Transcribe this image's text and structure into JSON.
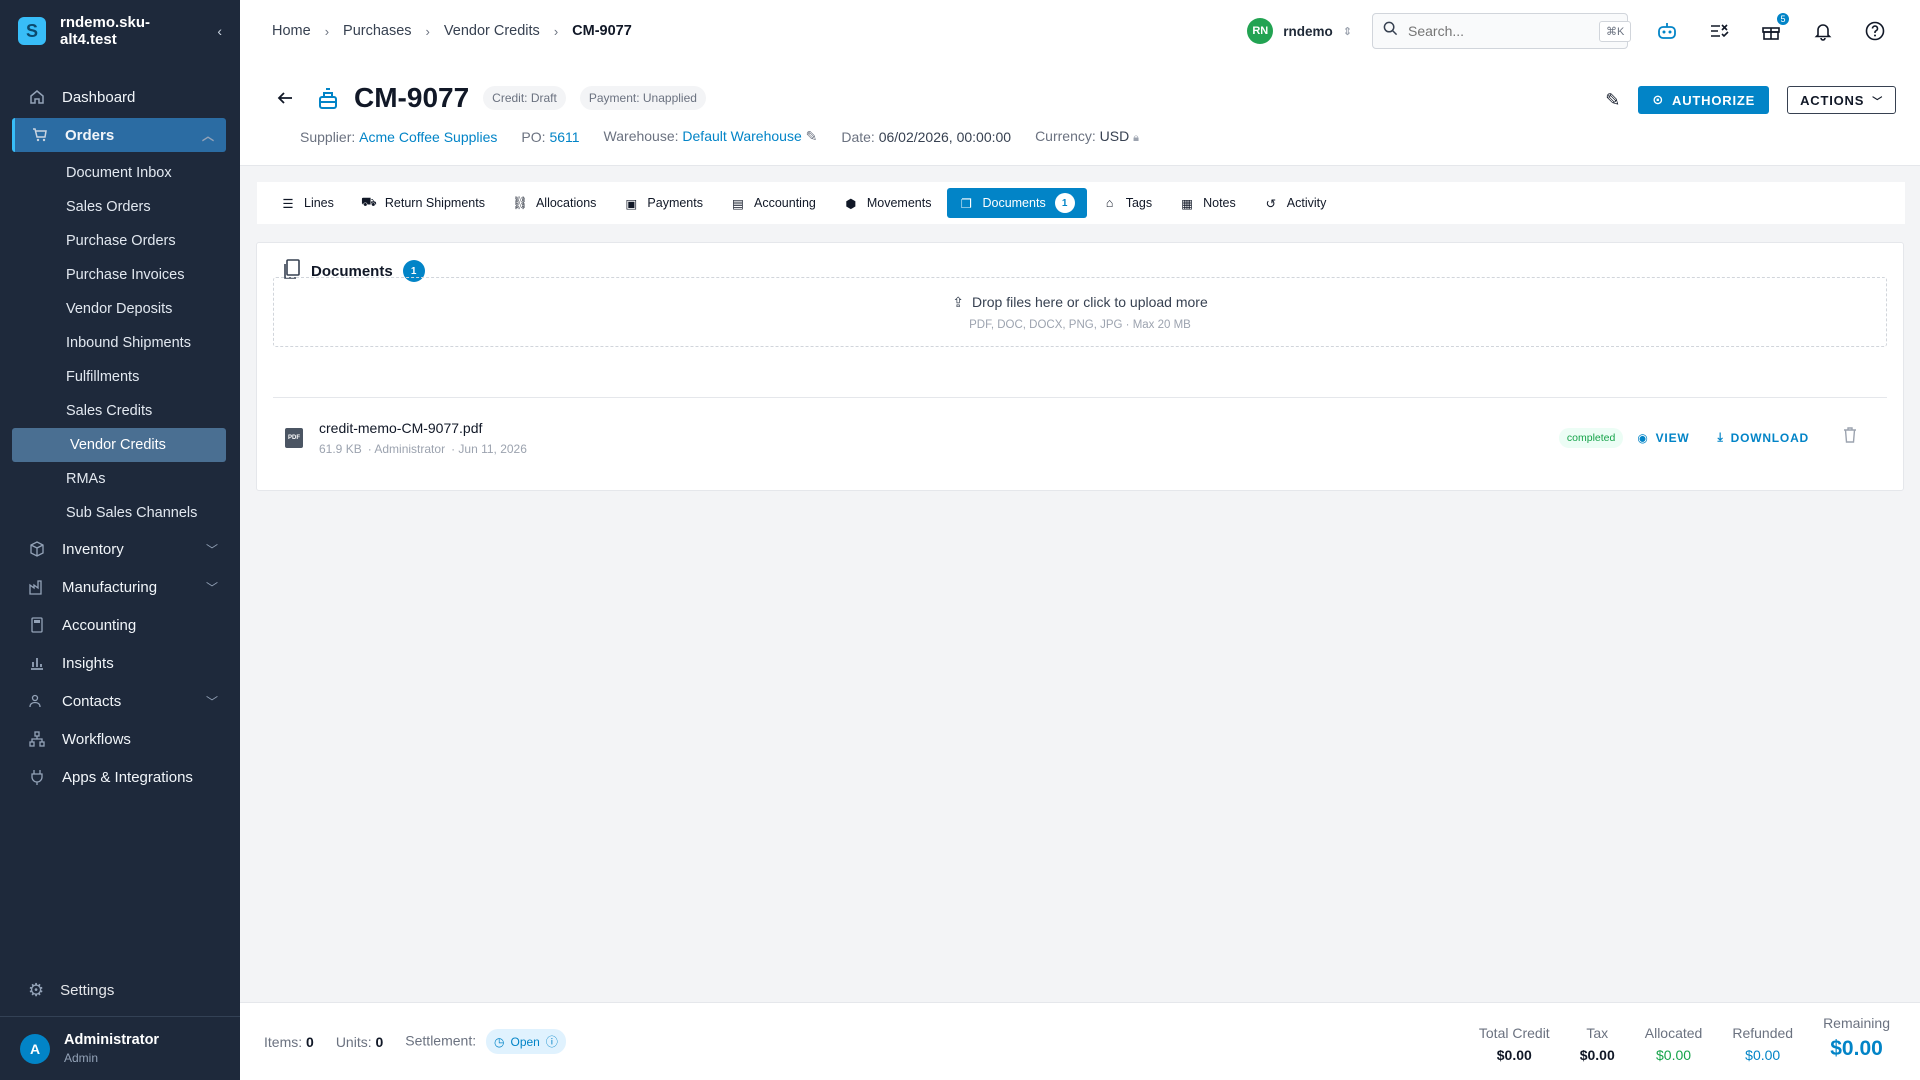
{
  "app": {
    "org_name": "rndemo.sku-alt4.test",
    "logo_letter": "S"
  },
  "sidebar": {
    "items": [
      {
        "label": "Dashboard",
        "icon": "home-icon"
      },
      {
        "label": "Orders",
        "icon": "cart-icon"
      },
      {
        "label": "Inventory",
        "icon": "box-icon"
      },
      {
        "label": "Manufacturing",
        "icon": "factory-icon"
      },
      {
        "label": "Accounting",
        "icon": "calculator-icon"
      },
      {
        "label": "Insights",
        "icon": "chart-icon"
      },
      {
        "label": "Contacts",
        "icon": "contacts-icon"
      },
      {
        "label": "Workflows",
        "icon": "workflow-icon"
      },
      {
        "label": "Apps & Integrations",
        "icon": "plug-icon"
      }
    ],
    "orders_sub": [
      "Document Inbox",
      "Sales Orders",
      "Purchase Orders",
      "Purchase Invoices",
      "Vendor Deposits",
      "Inbound Shipments",
      "Fulfillments",
      "Sales Credits",
      "Vendor Credits",
      "RMAs",
      "Sub Sales Channels"
    ],
    "settings_label": "Settings",
    "user": {
      "initial": "A",
      "name": "Administrator",
      "role": "Admin"
    }
  },
  "topbar": {
    "breadcrumbs": [
      "Home",
      "Purchases",
      "Vendor Credits",
      "CM-9077"
    ],
    "workspace": {
      "initials": "RN",
      "name": "rndemo"
    },
    "search_placeholder": "Search...",
    "search_shortcut": "⌘K",
    "gift_badge": "5"
  },
  "header": {
    "title": "CM-9077",
    "credit_chip": "Credit: Draft",
    "payment_chip": "Payment: Unapplied",
    "supplier_label": "Supplier:",
    "supplier": "Acme Coffee Supplies",
    "po_label": "PO:",
    "po": "5611",
    "warehouse_label": "Warehouse:",
    "warehouse": "Default Warehouse",
    "date_label": "Date:",
    "date": "06/02/2026, 00:00:00",
    "currency_label": "Currency:",
    "currency": "USD",
    "authorize_label": "AUTHORIZE",
    "actions_label": "ACTIONS"
  },
  "tabs": [
    {
      "label": "Lines"
    },
    {
      "label": "Return Shipments"
    },
    {
      "label": "Allocations"
    },
    {
      "label": "Payments"
    },
    {
      "label": "Accounting"
    },
    {
      "label": "Movements"
    },
    {
      "label": "Documents",
      "count": "1"
    },
    {
      "label": "Tags"
    },
    {
      "label": "Notes"
    },
    {
      "label": "Activity"
    }
  ],
  "documents": {
    "title": "Documents",
    "count": "1",
    "drop_text": "Drop files here or click to upload more",
    "drop_hint": "PDF, DOC, DOCX, PNG, JPG · Max 20 MB",
    "file": {
      "type_label": "PDF",
      "name": "credit-memo-CM-9077.pdf",
      "size": "61.9 KB",
      "uploader": "· Administrator",
      "date": "· Jun 11, 2026",
      "status": "completed",
      "view_label": "VIEW",
      "download_label": "DOWNLOAD"
    }
  },
  "footer": {
    "items_label": "Items:",
    "items": "0",
    "units_label": "Units:",
    "units": "0",
    "settlement_label": "Settlement:",
    "settlement": "Open",
    "totals": {
      "total_credit_label": "Total Credit",
      "total_credit": "$0.00",
      "tax_label": "Tax",
      "tax": "$0.00",
      "allocated_label": "Allocated",
      "allocated": "$0.00",
      "refunded_label": "Refunded",
      "refunded": "$0.00",
      "remaining_label": "Remaining",
      "remaining": "$0.00"
    }
  },
  "colors": {
    "accent": "#0284c7",
    "sidebar_bg": "#1e293b",
    "success": "#16a34a"
  }
}
